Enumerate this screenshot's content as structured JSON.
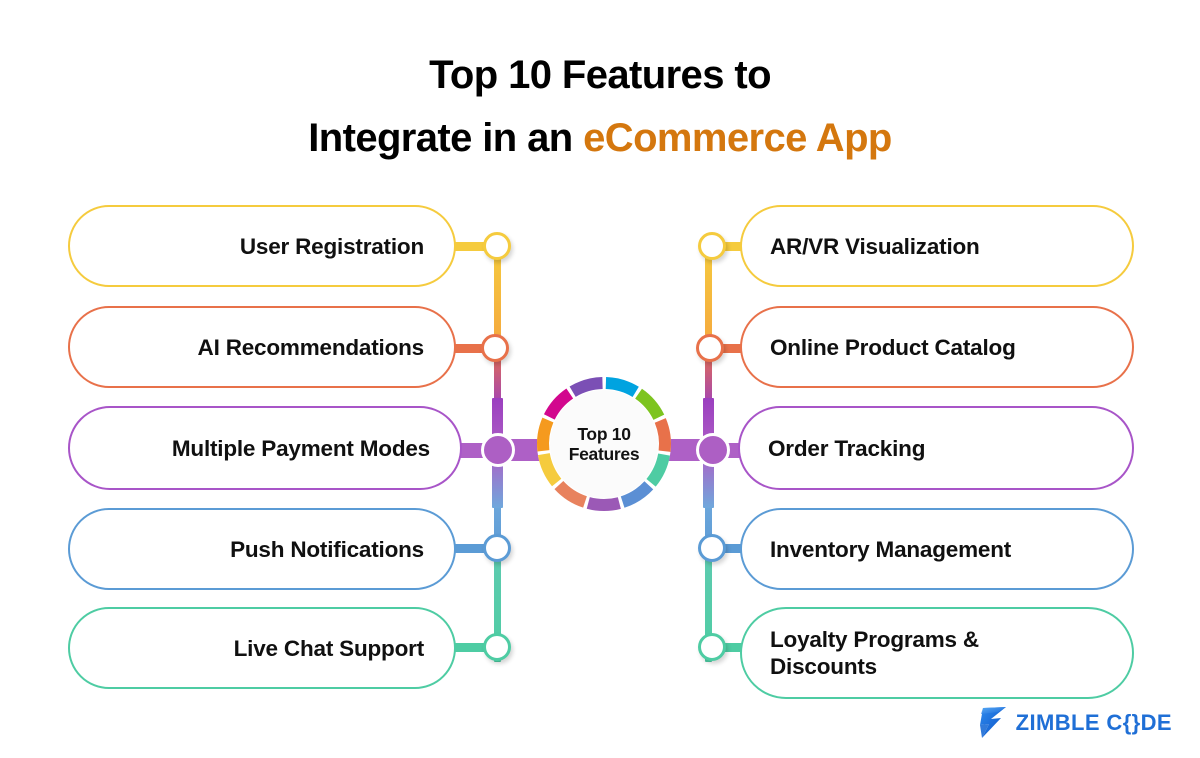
{
  "title": {
    "line1": "Top 10 Features to",
    "line2_plain": "Integrate in an ",
    "line2_accent": "eCommerce App",
    "accent_color": "#D4770E"
  },
  "hub": {
    "line1": "Top 10",
    "line2": "Features",
    "ring_segments": [
      {
        "color": "#F59A1E",
        "label": "orange"
      },
      {
        "color": "#D2078E",
        "label": "magenta"
      },
      {
        "color": "#7B4FB5",
        "label": "violet"
      },
      {
        "color": "#00A3E0",
        "label": "azure"
      },
      {
        "color": "#7DC41F",
        "label": "green"
      },
      {
        "color": "#E8714A",
        "label": "coral"
      },
      {
        "color": "#4ECCA3",
        "label": "teal"
      },
      {
        "color": "#5B8FD4",
        "label": "blue"
      },
      {
        "color": "#9B59B6",
        "label": "purple"
      },
      {
        "color": "#E8825E",
        "label": "salmon"
      },
      {
        "color": "#F5CB3E",
        "label": "yellow"
      }
    ]
  },
  "features": {
    "left": [
      {
        "label": "User Registration",
        "color": "#F5CB3E"
      },
      {
        "label": "AI Recommendations",
        "color": "#E8714A"
      },
      {
        "label": "Multiple Payment Modes",
        "color": "#A855C8"
      },
      {
        "label": "Push Notifications",
        "color": "#5B9BD5"
      },
      {
        "label": "Live Chat Support",
        "color": "#4ECCA3"
      }
    ],
    "right": [
      {
        "label": "AR/VR Visualization",
        "color": "#F5CB3E"
      },
      {
        "label": "Online Product Catalog",
        "color": "#E8714A"
      },
      {
        "label": "Order Tracking",
        "color": "#A855C8"
      },
      {
        "label": "Inventory Management",
        "color": "#5B9BD5"
      },
      {
        "label": "Loyalty Programs & Discounts",
        "color": "#4ECCA3"
      }
    ]
  },
  "logo": {
    "mark": "zimble-z-mark",
    "text": "ZIMBLE C{}DE",
    "color": "#1F6FD6"
  }
}
